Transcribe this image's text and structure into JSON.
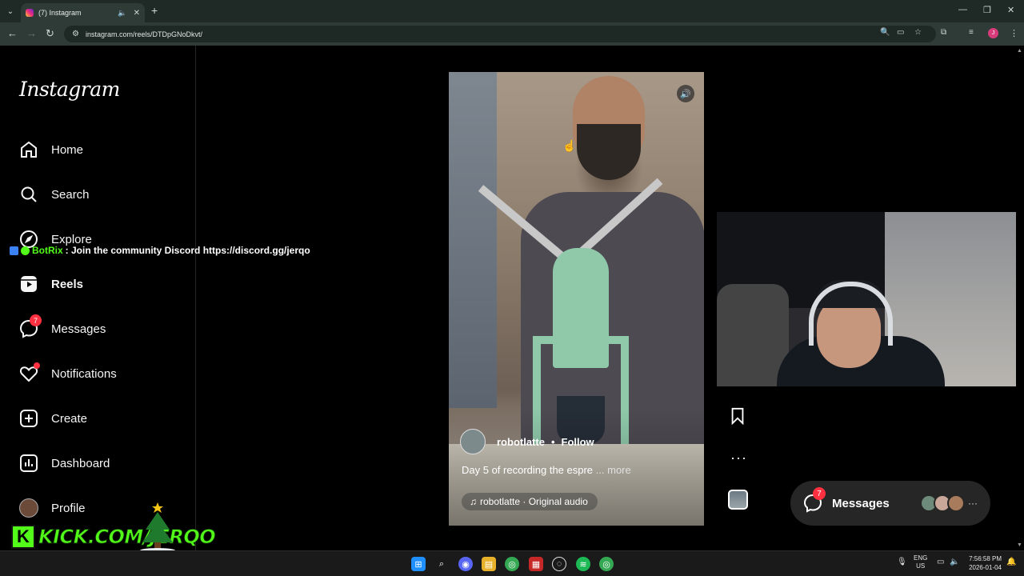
{
  "browser": {
    "tab_title": "(7) Instagram",
    "url": "instagram.com/reels/DTDpGNoDkvt/",
    "profile_initial": "J"
  },
  "sidebar": {
    "logo": "Instagram",
    "items": [
      {
        "label": "Home",
        "icon": "home-icon"
      },
      {
        "label": "Search",
        "icon": "search-icon"
      },
      {
        "label": "Explore",
        "icon": "compass-icon"
      },
      {
        "label": "Reels",
        "icon": "reels-icon"
      },
      {
        "label": "Messages",
        "icon": "messenger-icon",
        "badge": "7"
      },
      {
        "label": "Notifications",
        "icon": "heart-icon"
      },
      {
        "label": "Create",
        "icon": "plus-square-icon"
      },
      {
        "label": "Dashboard",
        "icon": "dashboard-icon"
      },
      {
        "label": "Profile",
        "icon": "avatar"
      }
    ]
  },
  "chat_overlay": {
    "user": "BotRix",
    "message": ": Join the community Discord https://discord.gg/jerqo"
  },
  "reel": {
    "username": "robotlatte",
    "separator": "•",
    "follow_label": "Follow",
    "caption": "Day 5 of recording the espre",
    "more_label": "... more",
    "audio": "robotlatte · Original audio"
  },
  "messages_pill": {
    "label": "Messages",
    "badge": "7"
  },
  "stream_overlay": {
    "kick_text": "KICK.COM/JERQO"
  },
  "taskbar": {
    "lang_line1": "ENG",
    "lang_line2": "US",
    "time": "7:56:58 PM",
    "date": "2026-01-04"
  },
  "colors": {
    "accent_red": "#ff3040",
    "kick_green": "#53fc18",
    "chrome_dark": "#1f2a27"
  }
}
